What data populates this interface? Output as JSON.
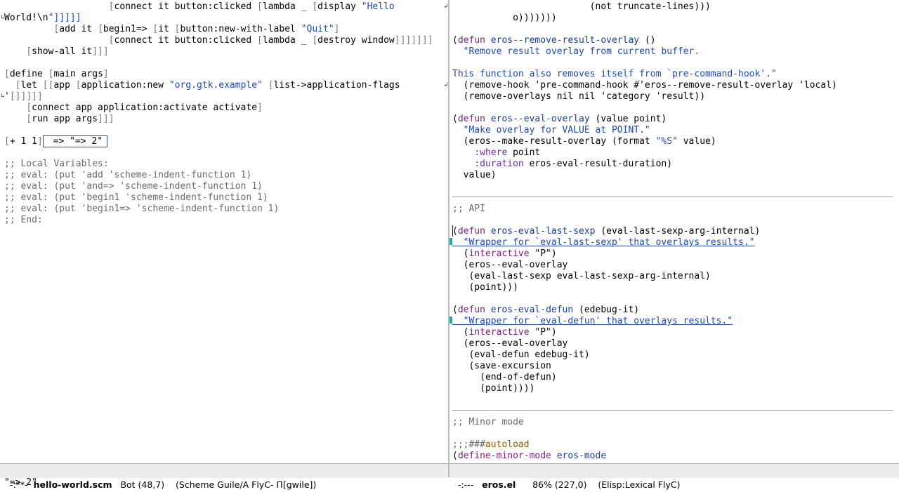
{
  "left_buffer": {
    "lines": [
      {
        "text": "                   [connect it button:clicked [lambda _ [display \"Hello"
      },
      {
        "text": "World!\\n\"]]]]]"
      },
      {
        "text": "         [add it [begin1=> [it [button:new-with-label \"Quit\"]"
      },
      {
        "text": "                   [connect it button:clicked [lambda _ [destroy window]]]]]]]"
      },
      {
        "text": "    [show-all it]]]"
      },
      {
        "text": ""
      },
      {
        "text": "[define [main args]"
      },
      {
        "text": "  [let [[app [application:new \"org.gtk.example\" [list->application-flags"
      },
      {
        "text": "'[]]]]]"
      },
      {
        "text": "    [connect app application:activate activate]"
      },
      {
        "text": "    [run app args]]]"
      },
      {
        "text": ""
      },
      {
        "text": "[+ 1 1]"
      },
      {
        "text": ""
      },
      {
        "text": ";; Local Variables:"
      },
      {
        "text": ";; eval: (put 'add 'scheme-indent-function 1)"
      },
      {
        "text": ";; eval: (put 'and=> 'scheme-indent-function 1)"
      },
      {
        "text": ";; eval: (put 'begin1 'scheme-indent-function 1)"
      },
      {
        "text": ";; eval: (put 'begin1=> 'scheme-indent-function 1)"
      },
      {
        "text": ";; End:"
      }
    ],
    "eval_overlay": " => \"=> 2\""
  },
  "right_buffer": {
    "lines": [
      "                         (not truncate-lines)))",
      "           o)))))))",
      "",
      "(defun eros--remove-result-overlay ()",
      "  \"Remove result overlay from current buffer.",
      "",
      "This function also removes itself from `pre-command-hook'.\"",
      "  (remove-hook 'pre-command-hook #'eros--remove-result-overlay 'local)",
      "  (remove-overlays nil nil 'category 'result))",
      "",
      "(defun eros--eval-overlay (value point)",
      "  \"Make overlay for VALUE at POINT.\"",
      "  (eros--make-result-overlay (format \"%S\" value)",
      "    :where point",
      "    :duration eros-eval-result-duration)",
      "  value)",
      "",
      "",
      ";; API",
      "",
      "(defun eros-eval-last-sexp (eval-last-sexp-arg-internal)",
      "  \"Wrapper for `eval-last-sexp' that overlays results.\"",
      "  (interactive \"P\")",
      "  (eros--eval-overlay",
      "   (eval-last-sexp eval-last-sexp-arg-internal)",
      "   (point)))",
      "",
      "(defun eros-eval-defun (edebug-it)",
      "  \"Wrapper for `eval-defun' that overlays results.\"",
      "  (interactive \"P\")",
      "  (eros--eval-overlay",
      "   (eval-defun edebug-it)",
      "   (save-excursion",
      "     (end-of-defun)",
      "     (point))))",
      "",
      "",
      ";; Minor mode",
      "",
      ";;;###autoload",
      "(define-minor-mode eros-mode"
    ]
  },
  "modeline_left": {
    "state": "-:**-",
    "buffer_name": "hello-world.scm",
    "position": "Bot (48,7)",
    "modes": "(Scheme Guile/A FlyC- Π[gwile])"
  },
  "modeline_right": {
    "state": "-:---",
    "buffer_name": "eros.el",
    "position": "86% (227,0)",
    "modes": "(Elisp:Lexical FlyC)"
  },
  "minibuffer": "\"=> 2\"",
  "colors": {
    "keyword": "#7a1e7a",
    "function_name": "#1d3b8a",
    "string": "#2448a8",
    "comment": "#6b6b6b",
    "fringe_marker": "#24a6b5"
  }
}
